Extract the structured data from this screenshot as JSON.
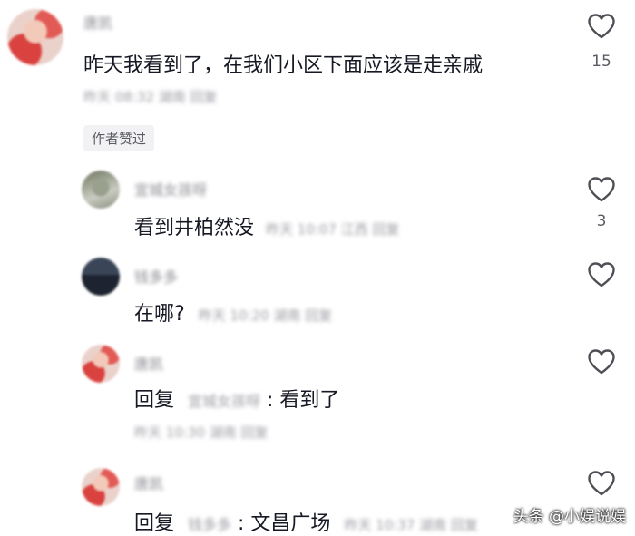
{
  "comments": [
    {
      "username": "唐凯",
      "text": "昨天我看到了，在我们小区下面应该是走亲戚",
      "meta": "昨天 08:32 湖南 回复",
      "like_count": "15",
      "author_liked": "作者赞过"
    },
    {
      "username": "宜城女孩呀",
      "text": "看到井柏然没",
      "meta": "昨天 10:07 江西 回复",
      "like_count": "3"
    },
    {
      "username": "钱多多",
      "text": "在哪?",
      "meta": "昨天 10:20 湖南 回复",
      "like_count": ""
    },
    {
      "username": "唐凯",
      "reply_prefix": "回复",
      "reply_to": "宜城女孩呀",
      "text": ": 看到了",
      "meta": "昨天 10:30 湖南 回复",
      "like_count": ""
    },
    {
      "username": "唐凯",
      "reply_prefix": "回复",
      "reply_to": "钱多多",
      "text": ": 文昌广场",
      "meta": "昨天 10:37 湖南 回复",
      "like_count": ""
    }
  ],
  "watermark": "头条 @小娱说娱",
  "icons": {
    "like": "heart-outline-icon"
  }
}
